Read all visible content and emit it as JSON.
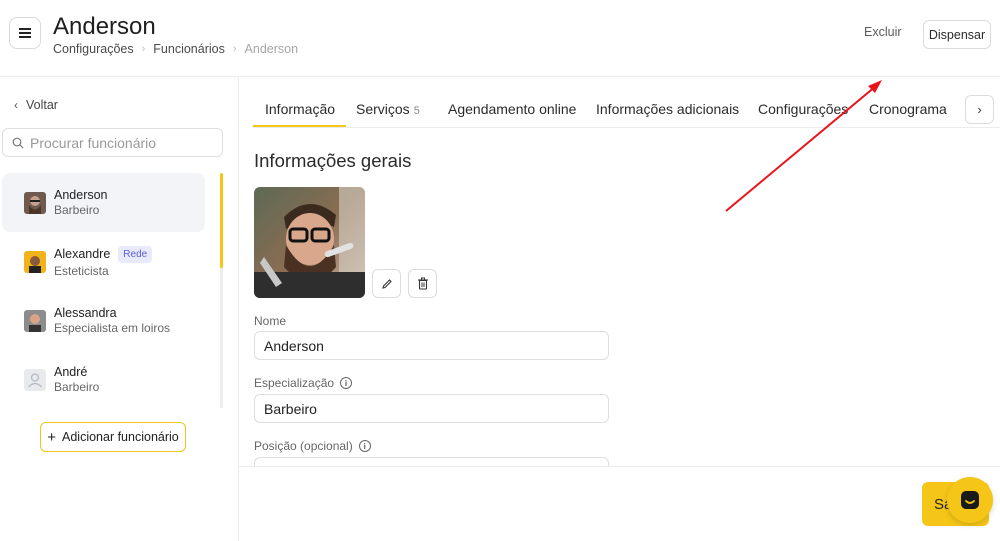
{
  "header": {
    "title": "Anderson",
    "breadcrumb": [
      "Configurações",
      "Funcionários",
      "Anderson"
    ],
    "delete_label": "Excluir",
    "dismiss_label": "Dispensar"
  },
  "sidebar": {
    "back_label": "Voltar",
    "search_placeholder": "Procurar funcionário",
    "employees": [
      {
        "name": "Anderson",
        "role": "Barbeiro",
        "badge": ""
      },
      {
        "name": "Alexandre",
        "role": "Esteticista",
        "badge": "Rede"
      },
      {
        "name": "Alessandra",
        "role": "Especialista em loiros",
        "badge": ""
      },
      {
        "name": "André",
        "role": "Barbeiro",
        "badge": ""
      }
    ],
    "add_label": "Adicionar funcionário"
  },
  "tabs": [
    {
      "label": "Informação",
      "count": ""
    },
    {
      "label": "Serviços",
      "count": "5"
    },
    {
      "label": "Agendamento online",
      "count": ""
    },
    {
      "label": "Informações adicionais",
      "count": ""
    },
    {
      "label": "Configurações",
      "count": ""
    },
    {
      "label": "Cronograma",
      "count": ""
    }
  ],
  "main": {
    "section_title": "Informações gerais",
    "fields": {
      "name_label": "Nome",
      "name_value": "Anderson",
      "specialization_label": "Especialização",
      "specialization_value": "Barbeiro",
      "position_label": "Posição (opcional)"
    },
    "save_label": "Sa"
  },
  "colors": {
    "accent": "#f5c518",
    "badge_text": "#5b5fd6",
    "badge_bg": "#e8e9fb",
    "annotation_arrow": "#e8141b"
  }
}
